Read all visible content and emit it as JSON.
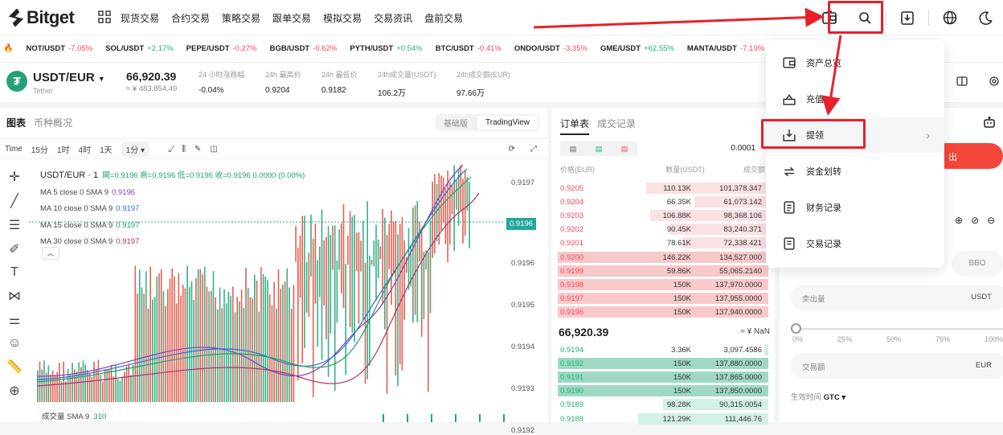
{
  "header": {
    "logo_text": "Bitget",
    "nav": [
      "现货交易",
      "合约交易",
      "策略交易",
      "跟单交易",
      "模拟交易",
      "交易资讯",
      "盘前交易"
    ],
    "icons": [
      "wallet-icon",
      "search-icon",
      "download-icon",
      "globe-icon",
      "moon-icon"
    ]
  },
  "ticker": [
    {
      "sym": "NOT/USDT",
      "chg": "-7.05%",
      "dir": "dn"
    },
    {
      "sym": "SOL/USDT",
      "chg": "+2.17%",
      "dir": "up"
    },
    {
      "sym": "PEPE/USDT",
      "chg": "-0.27%",
      "dir": "dn"
    },
    {
      "sym": "BGB/USDT",
      "chg": "-0.62%",
      "dir": "dn"
    },
    {
      "sym": "PYTH/USDT",
      "chg": "+0.54%",
      "dir": "up"
    },
    {
      "sym": "BTC/USDT",
      "chg": "-0.41%",
      "dir": "dn"
    },
    {
      "sym": "ONDO/USDT",
      "chg": "-3.35%",
      "dir": "dn"
    },
    {
      "sym": "GME/USDT",
      "chg": "+62.55%",
      "dir": "up"
    },
    {
      "sym": "MANTA/USDT",
      "chg": "-7.19%",
      "dir": "dn"
    }
  ],
  "pair": {
    "name": "USDT/EUR",
    "sub": "Tether",
    "last_price": "66,920.39",
    "last_sub": "≈ ¥ 483,854.49",
    "stats": [
      {
        "label": "24 小时涨跌幅",
        "value": "-0.04%",
        "cls": "dn"
      },
      {
        "label": "24h 最高价",
        "value": "0.9204",
        "cls": ""
      },
      {
        "label": "24h 最低价",
        "value": "0.9182",
        "cls": ""
      },
      {
        "label": "24h成交量(USDT)",
        "value": "106.2万",
        "cls": ""
      },
      {
        "label": "24h成交额(EUR)",
        "value": "97.66万",
        "cls": ""
      }
    ]
  },
  "chart": {
    "tabs": [
      "图表",
      "币种概况"
    ],
    "views": [
      "基础版",
      "TradingView"
    ],
    "tools": {
      "time": "Time",
      "tf1": "15分",
      "tf2": "1时",
      "tf3": "4时",
      "tf4": "1天",
      "tf_sel": "1分 ▾"
    },
    "legend": {
      "title": "USDT/EUR · 1",
      "ohlc": "開=0.9196 高=0.9196 低=0.9196 收=0.9196 0.0000 (0.00%)",
      "ma": [
        {
          "label": "MA 5 close 0 SMA 9",
          "val": "0.9196",
          "color": "#7b3fbf"
        },
        {
          "label": "MA 10 close 0 SMA 9",
          "val": "0.9197",
          "color": "#2f6fd6"
        },
        {
          "label": "MA 15 close 0 SMA 9",
          "val": "0.9197",
          "color": "#20a06a"
        },
        {
          "label": "MA 30 close 0 SMA 9",
          "val": "0.9197",
          "color": "#b0306a"
        }
      ]
    },
    "axis": [
      "0.9197",
      "0.9196",
      "0.9195",
      "0.9194",
      "0.9193",
      "0.9192"
    ],
    "current_price": "0.9196",
    "vol_label": "成交量 SMA 9",
    "vol_value": "310"
  },
  "orderbook": {
    "tabs": [
      "订单表",
      "成交记录"
    ],
    "precision": "0.0001",
    "headers": [
      "价格(EUR)",
      "数量(USDT)",
      "成交额"
    ],
    "asks": [
      {
        "p": "0.9205",
        "q": "110.13K",
        "t": "101,378.347",
        "w": 0.58
      },
      {
        "p": "0.9204",
        "q": "66.35K",
        "t": "61,073.142",
        "w": 0.35
      },
      {
        "p": "0.9203",
        "q": "106.88K",
        "t": "98,368.106",
        "w": 0.56
      },
      {
        "p": "0.9202",
        "q": "90.45K",
        "t": "83,240.371",
        "w": 0.47
      },
      {
        "p": "0.9201",
        "q": "78.61K",
        "t": "72,338.421",
        "w": 0.41
      },
      {
        "p": "0.9200",
        "q": "146.22K",
        "t": "134,527.000",
        "w": 0.75
      },
      {
        "p": "0.9199",
        "q": "59.86K",
        "t": "55,065.2140",
        "w": 0.31
      },
      {
        "p": "0.9198",
        "q": "150K",
        "t": "137,970.0000",
        "w": 0.76
      },
      {
        "p": "0.9197",
        "q": "150K",
        "t": "137,955.0000",
        "w": 0.76
      },
      {
        "p": "0.9196",
        "q": "150K",
        "t": "137,940.0000",
        "w": 0.76
      }
    ],
    "mid_price": "66,920.39",
    "mid_sub": "≈ ¥ NaN",
    "bids": [
      {
        "p": "0.9194",
        "q": "3.36K",
        "t": "3,097.4586",
        "w": 0.02
      },
      {
        "p": "0.9192",
        "q": "150K",
        "t": "137,880.0000",
        "w": 0.76
      },
      {
        "p": "0.9191",
        "q": "150K",
        "t": "137,865.0000",
        "w": 0.76
      },
      {
        "p": "0.9190",
        "q": "150K",
        "t": "137,850.0000",
        "w": 0.76
      },
      {
        "p": "0.9189",
        "q": "98.28K",
        "t": "90,315.0054",
        "w": 0.5
      },
      {
        "p": "0.9188",
        "q": "121.29K",
        "t": "111,446.76",
        "w": 0.62
      }
    ]
  },
  "trade": {
    "bbo": "BBO",
    "sell_label": "卖出量",
    "sell_unit": "USDT",
    "pct": [
      "0%",
      "25%",
      "50%",
      "75%",
      "100%"
    ],
    "amount_label": "交易额",
    "amount_unit": "EUR",
    "tif_label": "生效时间",
    "tif_value": "GTC ▾",
    "buy_label": "出"
  },
  "menu": {
    "items": [
      {
        "label": "资产总览",
        "icon": "asset-overview-icon"
      },
      {
        "label": "充值",
        "icon": "deposit-icon"
      },
      {
        "label": "提领",
        "icon": "withdraw-icon"
      },
      {
        "label": "资金划转",
        "icon": "transfer-icon"
      },
      {
        "label": "财务记录",
        "icon": "financial-records-icon"
      },
      {
        "label": "交易记录",
        "icon": "trade-records-icon"
      }
    ]
  },
  "colors": {
    "up": "#20b26c",
    "down": "#f5465c",
    "accent": "#00b7c3",
    "annotation": "#e8202a"
  }
}
